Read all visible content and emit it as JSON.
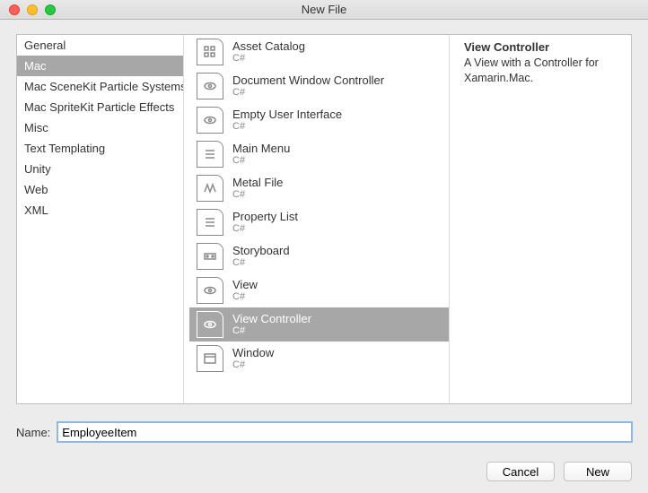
{
  "window": {
    "title": "New File"
  },
  "categories": [
    {
      "label": "General"
    },
    {
      "label": "Mac",
      "selected": true
    },
    {
      "label": "Mac SceneKit Particle Systems"
    },
    {
      "label": "Mac SpriteKit Particle Effects"
    },
    {
      "label": "Misc"
    },
    {
      "label": "Text Templating"
    },
    {
      "label": "Unity"
    },
    {
      "label": "Web"
    },
    {
      "label": "XML"
    }
  ],
  "templates": [
    {
      "name": "Asset Catalog",
      "sub": "C#",
      "icon": "grid"
    },
    {
      "name": "Document Window Controller",
      "sub": "C#",
      "icon": "eye"
    },
    {
      "name": "Empty User Interface",
      "sub": "C#",
      "icon": "eye"
    },
    {
      "name": "Main Menu",
      "sub": "C#",
      "icon": "lines"
    },
    {
      "name": "Metal File",
      "sub": "C#",
      "icon": "metal"
    },
    {
      "name": "Property List",
      "sub": "C#",
      "icon": "lines"
    },
    {
      "name": "Storyboard",
      "sub": "C#",
      "icon": "storyboard"
    },
    {
      "name": "View",
      "sub": "C#",
      "icon": "eye"
    },
    {
      "name": "View Controller",
      "sub": "C#",
      "icon": "eye",
      "selected": true
    },
    {
      "name": "Window",
      "sub": "C#",
      "icon": "window"
    }
  ],
  "details": {
    "title": "View Controller",
    "description": "A View with a Controller for Xamarin.Mac."
  },
  "form": {
    "name_label": "Name:",
    "name_value": "EmployeeItem"
  },
  "buttons": {
    "cancel": "Cancel",
    "new": "New"
  }
}
